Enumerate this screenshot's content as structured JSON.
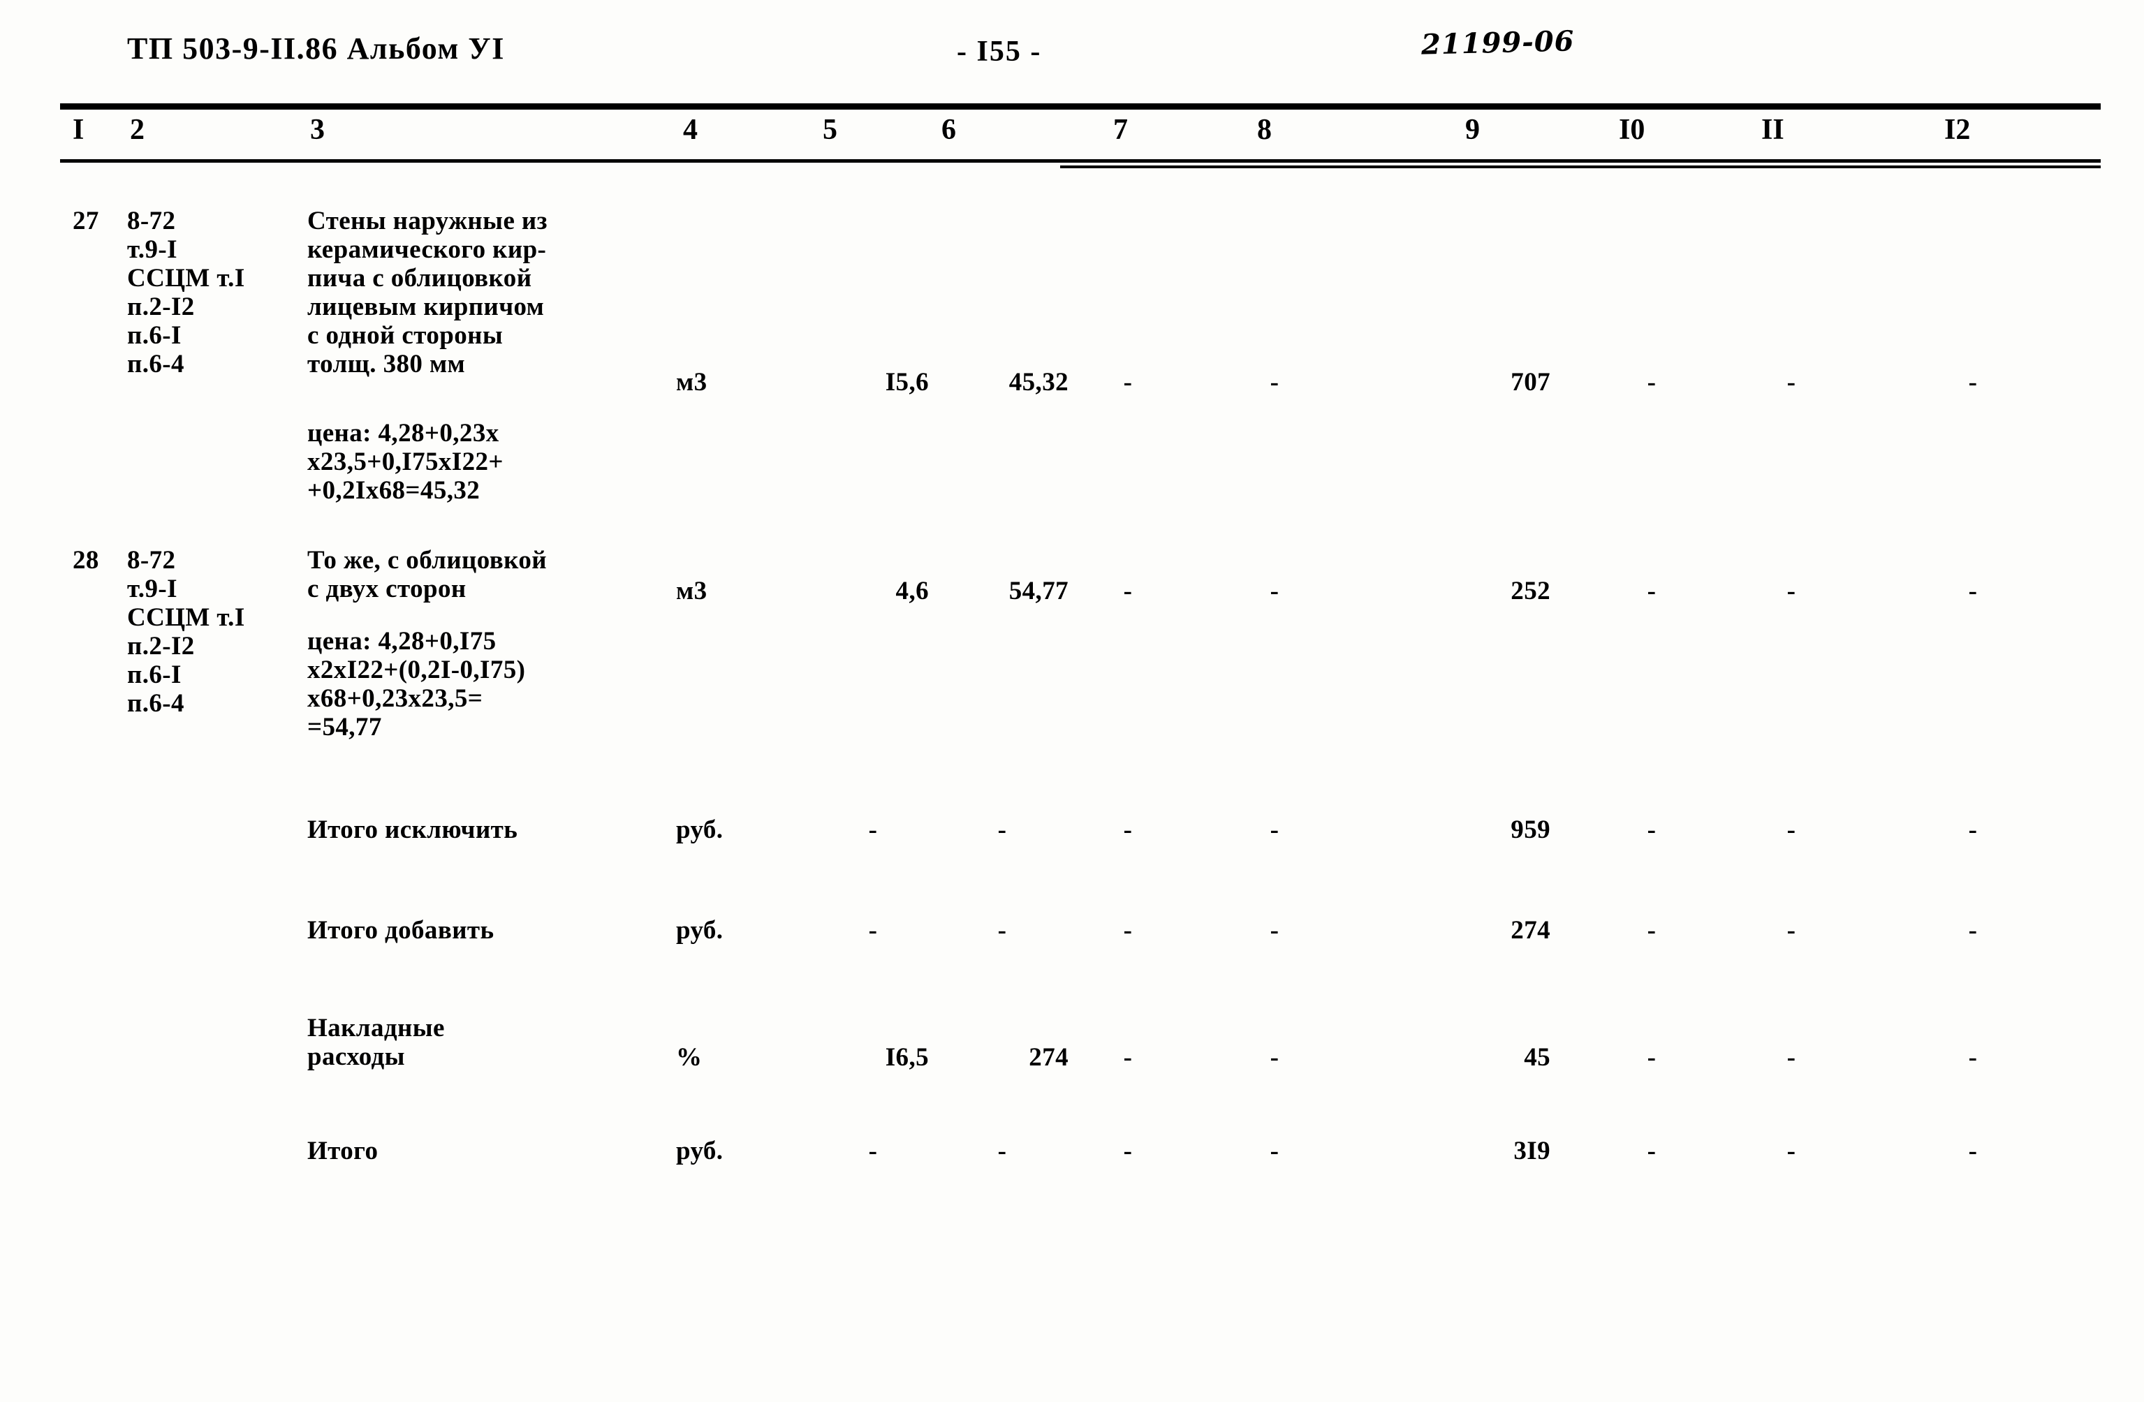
{
  "header": {
    "document_code": "ТП 503-9-II.86 Альбом УI",
    "page_label": "- I55 -",
    "archive_stamp": "21199-06"
  },
  "table": {
    "column_headers": [
      "I",
      "2",
      "3",
      "4",
      "5",
      "6",
      "7",
      "8",
      "9",
      "I0",
      "II",
      "I2"
    ],
    "rows": [
      {
        "no": "27",
        "codes": "8-72\nт.9-I\nССЦМ т.I\nп.2-I2\nп.6-I\nп.6-4",
        "description": "Стены наружные из\nкерамического кир-\nпича с облицовкой\nлицевым кирпичом\nс одной стороны\nтолщ. 380 мм",
        "note": "цена: 4,28+0,23х\nх23,5+0,I75хI22+\n+0,2Iх68=45,32",
        "unit": "м3",
        "c5": "I5,6",
        "c6": "45,32",
        "c7": "-",
        "c8": "-",
        "c9": "707",
        "c10": "-",
        "c11": "-",
        "c12": "-"
      },
      {
        "no": "28",
        "codes": "8-72\nт.9-I\nССЦМ т.I\nп.2-I2\nп.6-I\nп.6-4",
        "description": "То же, с облицовкой\nс двух сторон",
        "note": "цена: 4,28+0,I75\nх2хI22+(0,2I-0,I75)\nх68+0,23х23,5=\n=54,77",
        "unit": "м3",
        "c5": "4,6",
        "c6": "54,77",
        "c7": "-",
        "c8": "-",
        "c9": "252",
        "c10": "-",
        "c11": "-",
        "c12": "-"
      }
    ],
    "summary_rows": [
      {
        "label": "Итого исключить",
        "unit": "руб.",
        "c5": "-",
        "c6": "-",
        "c7": "-",
        "c8": "-",
        "c9": "959",
        "c10": "-",
        "c11": "-",
        "c12": "-"
      },
      {
        "label": "Итого добавить",
        "unit": "руб.",
        "c5": "-",
        "c6": "-",
        "c7": "-",
        "c8": "-",
        "c9": "274",
        "c10": "-",
        "c11": "-",
        "c12": "-"
      },
      {
        "label": "Накладные\nрасходы",
        "unit": "%",
        "c5": "I6,5",
        "c6": "274",
        "c7": "-",
        "c8": "-",
        "c9": "45",
        "c10": "-",
        "c11": "-",
        "c12": "-"
      },
      {
        "label": "Итого",
        "unit": "руб.",
        "c5": "-",
        "c6": "-",
        "c7": "-",
        "c8": "-",
        "c9": "3I9",
        "c10": "-",
        "c11": "-",
        "c12": "-"
      }
    ]
  }
}
